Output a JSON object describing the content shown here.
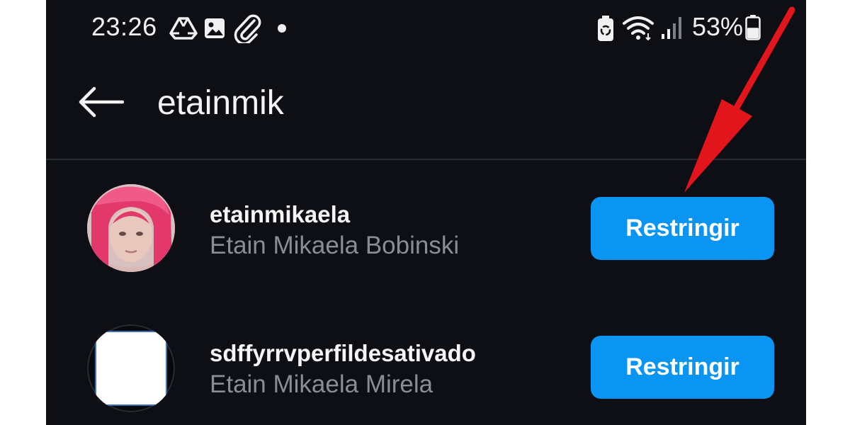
{
  "status_bar": {
    "time": "23:26",
    "battery_percent": "53%",
    "battery_level": 0.53,
    "icons": [
      "drive-icon",
      "image-icon",
      "paperclip-icon",
      "dot-icon",
      "battery-saver-icon",
      "wifi-icon",
      "signal-icon",
      "battery-icon"
    ]
  },
  "header": {
    "back_icon": "arrow-left-icon",
    "search_value": "etainmik"
  },
  "results": [
    {
      "username": "etainmikaela",
      "full_name": "Etain Mikaela Bobinski",
      "button_label": "Restringir",
      "avatar": "profile-photo-pink-hair"
    },
    {
      "username": "sdffyrrvperfildesativado",
      "full_name": "Etain Mikaela Mirela",
      "button_label": "Restringir",
      "avatar": "blank-white-avatar"
    }
  ],
  "colors": {
    "background": "#0e0f14",
    "button": "#0a95f2",
    "secondary_text": "#8b8d94",
    "annotation_arrow": "#e3151c"
  }
}
